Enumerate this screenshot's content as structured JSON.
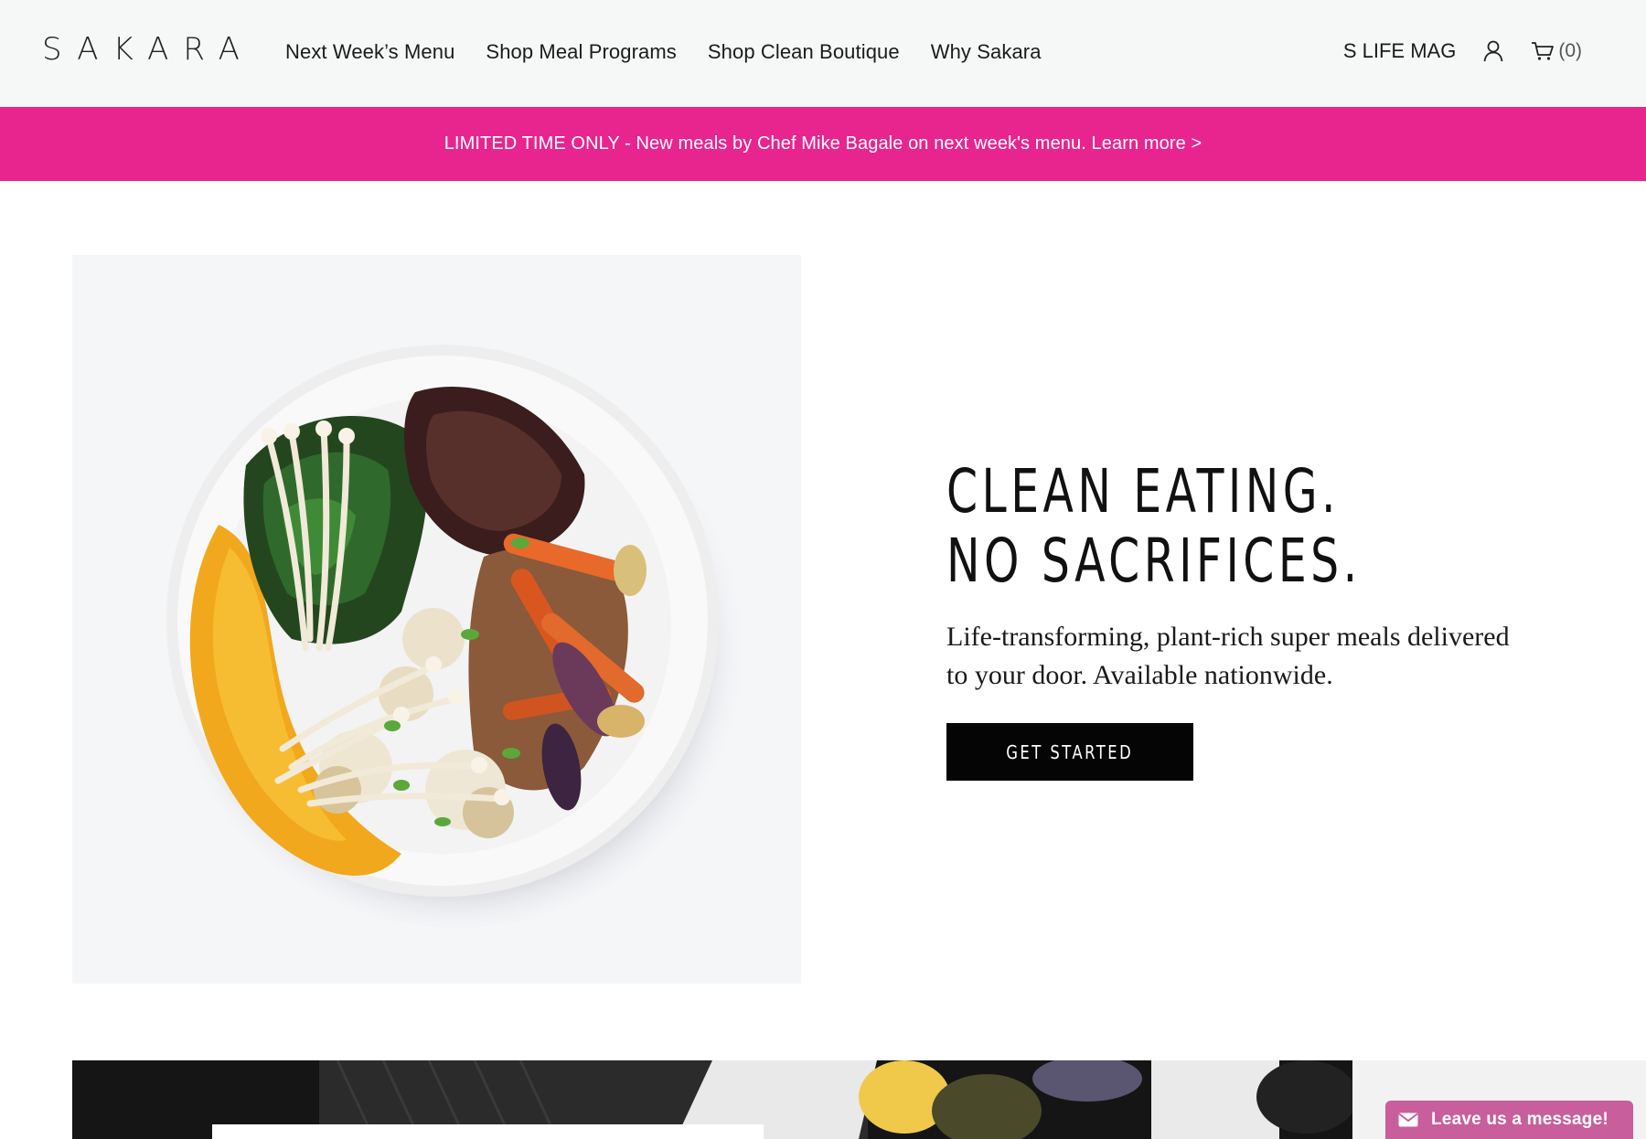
{
  "brand": {
    "logo_text": "SAKARA"
  },
  "nav": {
    "items": [
      {
        "label": "Next Week’s Menu"
      },
      {
        "label": "Shop Meal Programs"
      },
      {
        "label": "Shop Clean Boutique"
      },
      {
        "label": "Why Sakara"
      }
    ]
  },
  "utility_nav": {
    "magazine_label": "S LIFE MAG",
    "account_icon": "user-icon",
    "cart_icon": "cart-icon",
    "cart_count": "(0)"
  },
  "promo": {
    "text": "LIMITED TIME ONLY - New meals by Chef Mike Bagale on next week's menu. Learn more >",
    "background": "#e8248f"
  },
  "hero": {
    "title_line1": "CLEAN EATING.",
    "title_line2": "NO SACRIFICES.",
    "subtitle": "Life-transforming, plant-rich super meals delivered to your door. Available nationwide.",
    "cta_label": "GET STARTED"
  },
  "chat": {
    "label": "Leave us a message!",
    "icon": "envelope-icon",
    "background": "#c85e9c"
  }
}
